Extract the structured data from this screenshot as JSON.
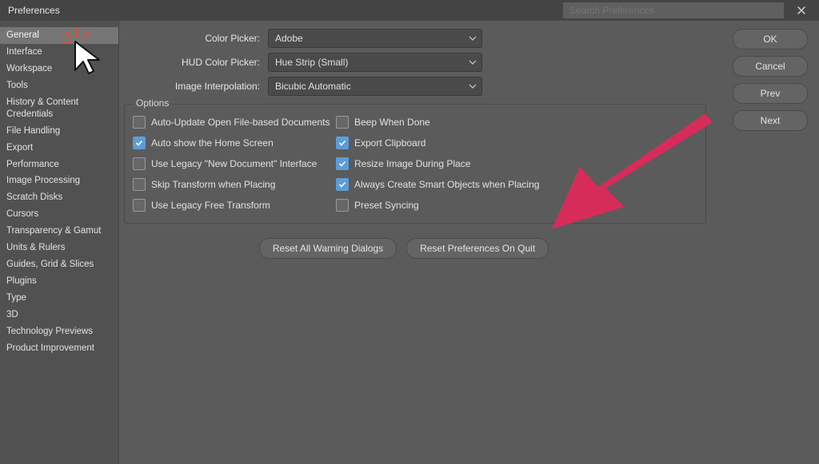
{
  "window": {
    "title": "Preferences",
    "search_placeholder": "Search Preferences"
  },
  "sidebar": {
    "items": [
      {
        "label": "General",
        "selected": true
      },
      {
        "label": "Interface"
      },
      {
        "label": "Workspace"
      },
      {
        "label": "Tools"
      },
      {
        "label": "History & Content Credentials"
      },
      {
        "label": "File Handling"
      },
      {
        "label": "Export"
      },
      {
        "label": "Performance"
      },
      {
        "label": "Image Processing"
      },
      {
        "label": "Scratch Disks"
      },
      {
        "label": "Cursors"
      },
      {
        "label": "Transparency & Gamut"
      },
      {
        "label": "Units & Rulers"
      },
      {
        "label": "Guides, Grid & Slices"
      },
      {
        "label": "Plugins"
      },
      {
        "label": "Type"
      },
      {
        "label": "3D"
      },
      {
        "label": "Technology Previews"
      },
      {
        "label": "Product Improvement"
      }
    ]
  },
  "selects": {
    "color_picker": {
      "label": "Color Picker:",
      "value": "Adobe"
    },
    "hud_color_picker": {
      "label": "HUD Color Picker:",
      "value": "Hue Strip (Small)"
    },
    "image_interpolation": {
      "label": "Image Interpolation:",
      "value": "Bicubic Automatic"
    }
  },
  "options": {
    "legend": "Options",
    "left": [
      {
        "label": "Auto-Update Open File-based Documents",
        "checked": false
      },
      {
        "label": "Auto show the Home Screen",
        "checked": true
      },
      {
        "label": "Use Legacy \"New Document\" Interface",
        "checked": false
      },
      {
        "label": "Skip Transform when Placing",
        "checked": false
      },
      {
        "label": "Use Legacy Free Transform",
        "checked": false
      }
    ],
    "right": [
      {
        "label": "Beep When Done",
        "checked": false
      },
      {
        "label": "Export Clipboard",
        "checked": true
      },
      {
        "label": "Resize Image During Place",
        "checked": true
      },
      {
        "label": "Always Create Smart Objects when Placing",
        "checked": true
      },
      {
        "label": "Preset Syncing",
        "checked": false
      }
    ]
  },
  "buttons": {
    "reset_warnings": "Reset All Warning Dialogs",
    "reset_on_quit": "Reset Preferences On Quit",
    "ok": "OK",
    "cancel": "Cancel",
    "prev": "Prev",
    "next": "Next"
  },
  "colors": {
    "accent_arrow": "#d72c5a"
  }
}
